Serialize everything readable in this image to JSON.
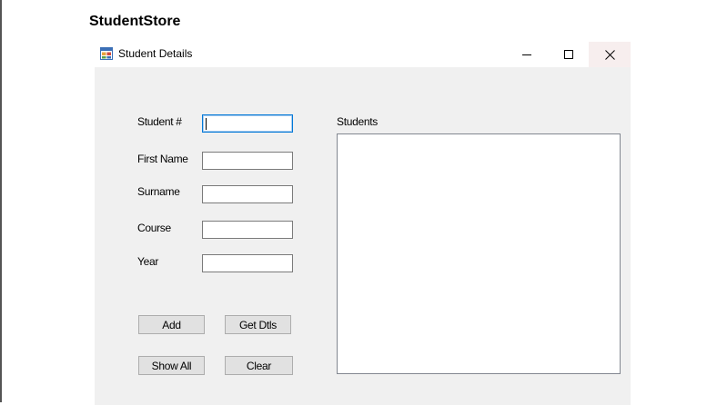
{
  "page": {
    "title": "StudentStore"
  },
  "window": {
    "title": "Student Details",
    "icon": "winforms-app-icon",
    "controls": {
      "minimize_icon": "minimize-icon",
      "maximize_icon": "maximize-icon",
      "close_icon": "close-icon"
    }
  },
  "form": {
    "fields": [
      {
        "label": "Student #",
        "value": "",
        "focused": true
      },
      {
        "label": "First Name",
        "value": ""
      },
      {
        "label": "Surname",
        "value": ""
      },
      {
        "label": "Course",
        "value": ""
      },
      {
        "label": "Year",
        "value": ""
      }
    ],
    "buttons": {
      "add": "Add",
      "get_details": "Get Dtls",
      "show_all": "Show All",
      "clear": "Clear"
    },
    "students": {
      "label": "Students",
      "items": []
    }
  },
  "colors": {
    "window_bg": "#f0f0f0",
    "focus_border": "#0078d7",
    "button_bg": "#e1e1e1"
  }
}
